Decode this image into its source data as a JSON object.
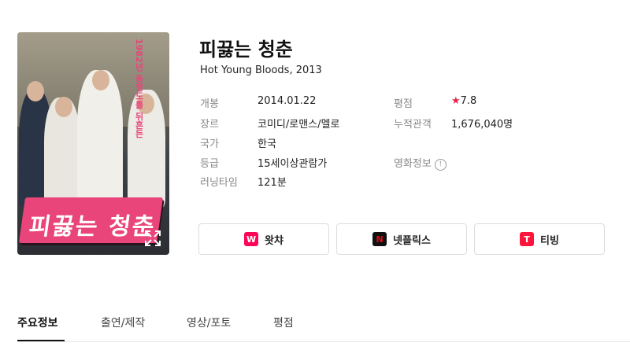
{
  "movie": {
    "title": "피끓는 청춘",
    "subtitle": "Hot Young Bloods, 2013"
  },
  "poster": {
    "title_art_text": "피끓는 청춘",
    "tagline_text": "1982년 충청도를 뒤흔든"
  },
  "info": {
    "release_label": "개봉",
    "release_value": "2014.01.22",
    "genre_label": "장르",
    "genre_value": "코미디/로맨스/멜로",
    "country_label": "국가",
    "country_value": "한국",
    "rating_label": "등급",
    "rating_value": "15세이상관람가",
    "runtime_label": "러닝타임",
    "runtime_value": "121분",
    "score_label": "평점",
    "score_star": "★",
    "score_value": "7.8",
    "audience_label": "누적관객",
    "audience_value": "1,676,040명",
    "movieinfo_label": "영화정보",
    "movieinfo_icon": "!"
  },
  "ott": [
    {
      "label": "왓챠",
      "icon": "watcha-icon",
      "color": "#ff0558",
      "letter": "W"
    },
    {
      "label": "넷플릭스",
      "icon": "netflix-icon",
      "color": "#111111",
      "letter": "N"
    },
    {
      "label": "티빙",
      "icon": "tving-icon",
      "color": "#ff153c",
      "letter": "T"
    }
  ],
  "tabs": [
    "주요정보",
    "출연/제작",
    "영상/포토",
    "평점"
  ],
  "colors": {
    "accent": "#e8234a"
  }
}
